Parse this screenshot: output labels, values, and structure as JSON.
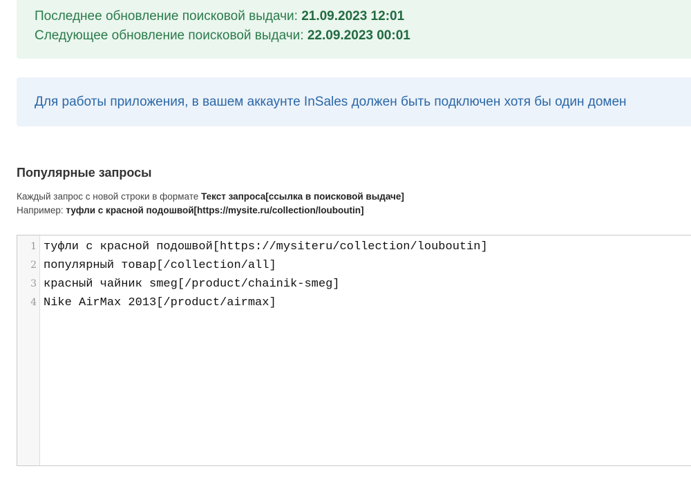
{
  "update_status": {
    "last_label": "Последнее обновление поисковой выдачи:",
    "last_value": "21.09.2023 12:01",
    "next_label": "Следующее обновление поисковой выдачи:",
    "next_value": "22.09.2023 00:01",
    "color": "#2b7a4b"
  },
  "domain_notice": {
    "text": "Для работы приложения, в вашем аккаунте InSales должен быть подключен хотя бы один домен",
    "color": "#2a68a8"
  },
  "popular_queries": {
    "title": "Популярные запросы",
    "hint_prefix": "Каждый запрос с новой строки в формате",
    "hint_format": "Текст запроса[ссылка в поисковой выдаче]",
    "example_prefix": "Например:",
    "example_value": "туфли с красной подошвой[https://mysite.ru/collection/louboutin]"
  },
  "editor": {
    "lines": [
      {
        "num": "1",
        "text": "туфли с красной подошвой[https://mysiteru/collection/louboutin]"
      },
      {
        "num": "2",
        "text": "популярный товар[/collection/all]"
      },
      {
        "num": "3",
        "text": "красный чайник smeg[/product/chainik-smeg]"
      },
      {
        "num": "4",
        "text": "Nike AirMax 2013[/product/airmax]"
      }
    ]
  }
}
